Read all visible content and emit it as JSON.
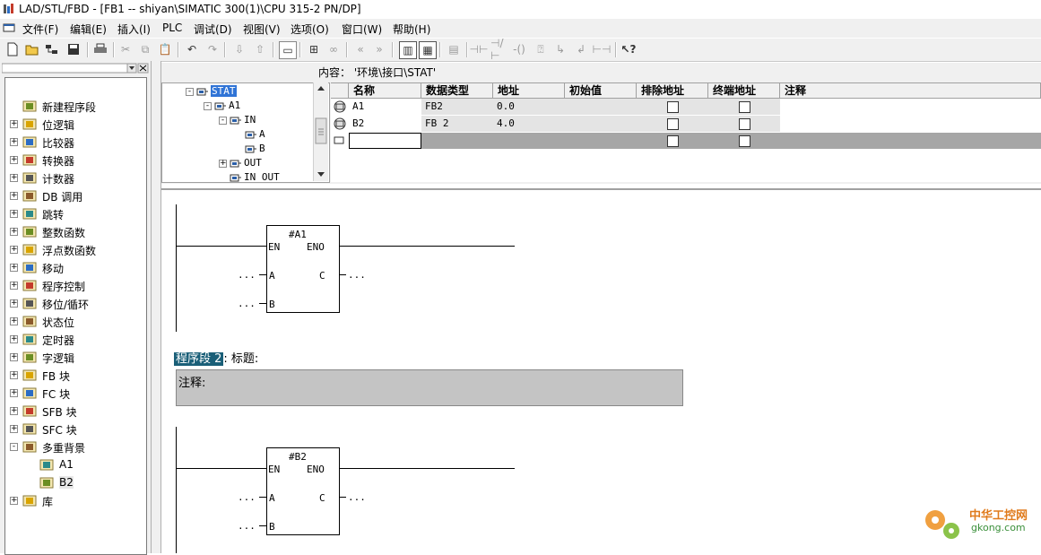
{
  "window": {
    "title": "LAD/STL/FBD  - [FB1 -- shiyan\\SIMATIC 300(1)\\CPU 315-2 PN/DP]"
  },
  "menu": [
    "文件(F)",
    "编辑(E)",
    "插入(I)",
    "PLC",
    "调试(D)",
    "视图(V)",
    "选项(O)",
    "窗口(W)",
    "帮助(H)"
  ],
  "toolbar_icons": [
    "new-icon",
    "open-icon",
    "accessible-nodes-icon",
    "save-icon",
    "print-icon",
    "cut-icon",
    "copy-icon",
    "paste-icon",
    "undo-icon",
    "redo-icon",
    "download-icon",
    "upload-icon",
    "comment-icon",
    "monitor-icon",
    "glasses-icon",
    "prev-icon",
    "next-icon",
    "overview-icon",
    "details-icon",
    "network-icon",
    "no-contact-icon",
    "nc-contact-icon",
    "coil-icon",
    "box-icon",
    "branch-open-icon",
    "branch-close-icon",
    "connection-icon",
    "help-icon"
  ],
  "left_tree": [
    {
      "label": "新建程序段",
      "expander": ""
    },
    {
      "label": "位逻辑",
      "expander": "+"
    },
    {
      "label": "比较器",
      "expander": "+"
    },
    {
      "label": "转换器",
      "expander": "+"
    },
    {
      "label": "计数器",
      "expander": "+"
    },
    {
      "label": "DB 调用",
      "expander": "+"
    },
    {
      "label": "跳转",
      "expander": "+"
    },
    {
      "label": "整数函数",
      "expander": "+"
    },
    {
      "label": "浮点数函数",
      "expander": "+"
    },
    {
      "label": "移动",
      "expander": "+"
    },
    {
      "label": "程序控制",
      "expander": "+"
    },
    {
      "label": "移位/循环",
      "expander": "+"
    },
    {
      "label": "状态位",
      "expander": "+"
    },
    {
      "label": "定时器",
      "expander": "+"
    },
    {
      "label": "字逻辑",
      "expander": "+"
    },
    {
      "label": "FB 块",
      "expander": "+"
    },
    {
      "label": "FC 块",
      "expander": "+"
    },
    {
      "label": "SFB 块",
      "expander": "+"
    },
    {
      "label": "SFC 块",
      "expander": "+"
    },
    {
      "label": "多重背景",
      "expander": "-"
    },
    {
      "label": "A1",
      "expander": ""
    },
    {
      "label": "B2",
      "expander": ""
    },
    {
      "label": "库",
      "expander": "+"
    }
  ],
  "interface": {
    "content_label": "内容：  '环境\\接口\\STAT'",
    "tree": [
      {
        "label": "STAT",
        "expander": "-",
        "selected": true
      },
      {
        "label": "A1",
        "expander": "-"
      },
      {
        "label": "IN",
        "expander": "-"
      },
      {
        "label": "A",
        "expander": ""
      },
      {
        "label": "B",
        "expander": ""
      },
      {
        "label": "OUT",
        "expander": "+"
      },
      {
        "label": "IN_OUT",
        "expander": ""
      }
    ],
    "columns": [
      "名称",
      "数据类型",
      "地址",
      "初始值",
      "排除地址",
      "终端地址",
      "注释"
    ],
    "rows": [
      {
        "name": "A1",
        "type": "FB2",
        "address": "0.0",
        "initial": "",
        "exclude": false,
        "terminal": false,
        "comment": ""
      },
      {
        "name": "B2",
        "type": "FB 2",
        "address": "4.0",
        "initial": "",
        "exclude": false,
        "terminal": false,
        "comment": ""
      },
      {
        "name": "",
        "type": "",
        "address": "",
        "initial": "",
        "exclude": false,
        "terminal": false,
        "comment": ""
      }
    ]
  },
  "networks": [
    {
      "instance": "#A1",
      "en": "EN",
      "eno": "ENO",
      "in1": "A",
      "in2": "B",
      "out": "C",
      "pin": "...",
      "title": ""
    },
    {
      "number_label": "程序段 2",
      "title_label": ": 标题:",
      "comment_label": "注释:",
      "instance": "#B2",
      "en": "EN",
      "eno": "ENO",
      "in1": "A",
      "in2": "B",
      "out": "C",
      "pin": "..."
    }
  ],
  "watermark": {
    "line1": "中华工控网",
    "line2": "gkong.com"
  }
}
